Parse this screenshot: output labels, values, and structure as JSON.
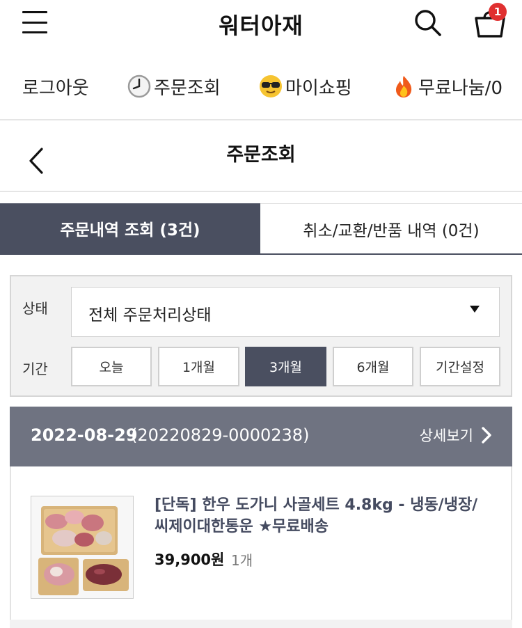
{
  "header": {
    "brand": "워터아재",
    "cart_count": "1"
  },
  "topnav": {
    "items": [
      {
        "label": "로그아웃",
        "icon": ""
      },
      {
        "label": "주문조회",
        "icon": "clock-icon"
      },
      {
        "label": "마이쇼핑",
        "icon": "sunglasses-face-icon"
      },
      {
        "label": "무료나눔/0",
        "icon": "fire-icon"
      }
    ]
  },
  "page": {
    "title": "주문조회"
  },
  "tabs": [
    {
      "label": "주문내역 조회 (3건)",
      "active": true
    },
    {
      "label": "취소/교환/반품 내역 (0건)",
      "active": false
    }
  ],
  "filter": {
    "status_label": "상태",
    "status_value": "전체 주문처리상태",
    "period_label": "기간",
    "periods": [
      "오늘",
      "1개월",
      "3개월",
      "6개월",
      "기간설정"
    ],
    "selected_period": "3개월"
  },
  "order": {
    "date": "2022-08-29",
    "order_no": "(20220829-0000238)",
    "detail_label": "상세보기",
    "product_name": "[단독] 한우 도가니 사골세트 4.8kg - 냉동/냉장/씨제이대한통운 ★무료배송",
    "price": "39,900원",
    "qty": "1개"
  },
  "colors": {
    "accent_dark": "#4a4f60",
    "order_header": "#6f7381",
    "badge": "#e03030",
    "product_text": "#454b60"
  }
}
